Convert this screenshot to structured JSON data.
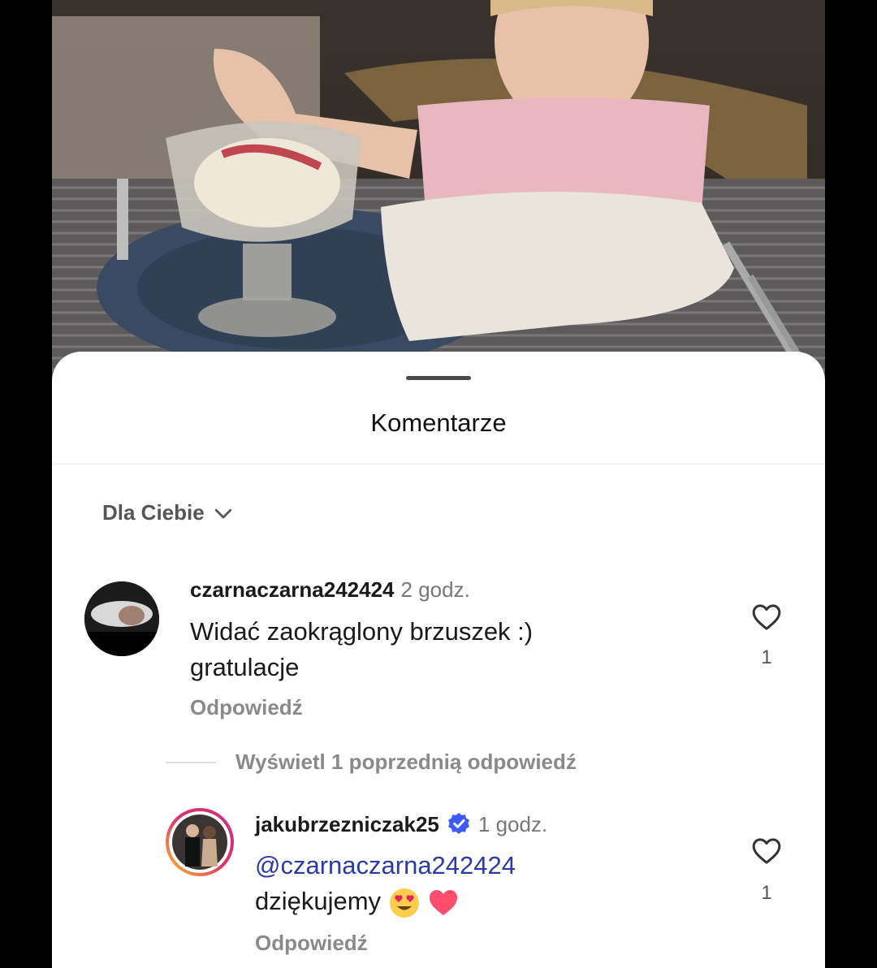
{
  "sheet": {
    "title": "Komentarze"
  },
  "sort": {
    "label": "Dla Ciebie"
  },
  "comments": [
    {
      "username": "czarnaczarna242424",
      "time": "2 godz.",
      "text_line1": "Widać zaokrąglony brzuszek :)",
      "text_line2": "gratulacje",
      "reply_label": "Odpowiedź",
      "likes": "1"
    }
  ],
  "view_replies": {
    "label": "Wyświetl 1 poprzednią odpowiedź"
  },
  "replies": [
    {
      "username": "jakubrzezniczak25",
      "time": "1 godz.",
      "mention": "@czarnaczarna242424",
      "text": "dziękujemy",
      "reply_label": "Odpowiedź",
      "likes": "1",
      "verified": true
    }
  ],
  "colors": {
    "mention": "#2a3aa8",
    "verified": "#3d5afe",
    "heart_emoji": "#ff4d6d"
  }
}
